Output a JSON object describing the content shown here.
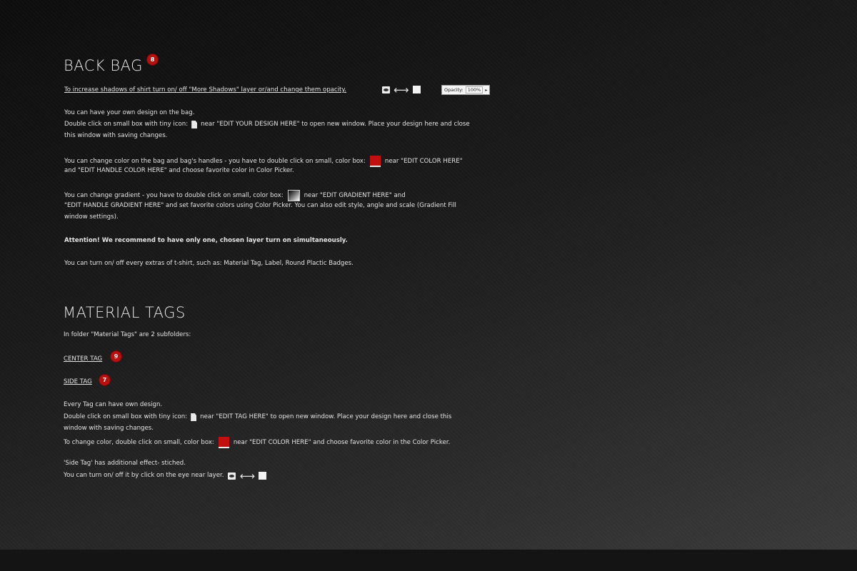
{
  "back_bag": {
    "title": "BACK BAG",
    "badge": "8",
    "shadow_tip": "To increase shadows of shirt turn on/ off \"More Shadows\" layer or/and change them opacity.",
    "opacity_label": "Opacity:",
    "opacity_value": "100%",
    "design_line1": "You can have your own design on the bag.",
    "design_line2a": "Double click on small box with tiny icon:",
    "design_line2b": "near \"EDIT YOUR DESIGN HERE\" to open new window. Place your design here and close",
    "design_line3": "this window with saving changes.",
    "color_line1a": "You can change color on the bag and bag's handles - you have to double click on small, color box:",
    "color_line1b": "near \"EDIT COLOR HERE\"",
    "color_line2": "and \"EDIT HANDLE COLOR HERE\" and choose favorite color in Color Picker.",
    "gradient_line1a": "You can change gradient - you have to double click on small, color box:",
    "gradient_line1b": "near \"EDIT GRADIENT HERE\" and",
    "gradient_line2": "\"EDIT HANDLE GRADIENT HERE\" and set favorite colors using Color Picker. You can also edit style, angle and scale (Gradient Fill",
    "gradient_line3": "window settings).",
    "attention": "Attention! We recommend to have only one, chosen layer turn on simultaneously.",
    "extras": "You can turn on/ off every extras of t-shirt, such as: Material Tag, Label, Round Plactic Badges."
  },
  "material_tags": {
    "title": "MATERIAL TAGS",
    "intro": "In folder \"Material Tags\" are 2 subfolders:",
    "center_tag": "CENTER TAG",
    "center_badge": "9",
    "side_tag": "SIDE TAG",
    "side_badge": "7",
    "design_line1": "Every Tag can have own design.",
    "design_line2a": "Double click on small box with tiny icon:",
    "design_line2b": "near \"EDIT TAG HERE\" to open new window. Place your design here and close this",
    "design_line3": "window with saving changes.",
    "color_line_a": "To change color, double click on small, color box:",
    "color_line_b": "near \"EDIT COLOR HERE\" and choose favorite color in the Color Picker.",
    "stitched_line1": "'Side Tag' has additional effect- stiched.",
    "stitched_line2": "You can turn on/ off it by click on the eye near layer."
  },
  "colors": {
    "badge": "#b80f0f",
    "swatch": "#c21010",
    "background": "#151515"
  },
  "icons": [
    "eye-icon",
    "arrow-icon",
    "empty-box-icon",
    "file-icon",
    "color-swatch-icon",
    "gradient-swatch-icon"
  ]
}
